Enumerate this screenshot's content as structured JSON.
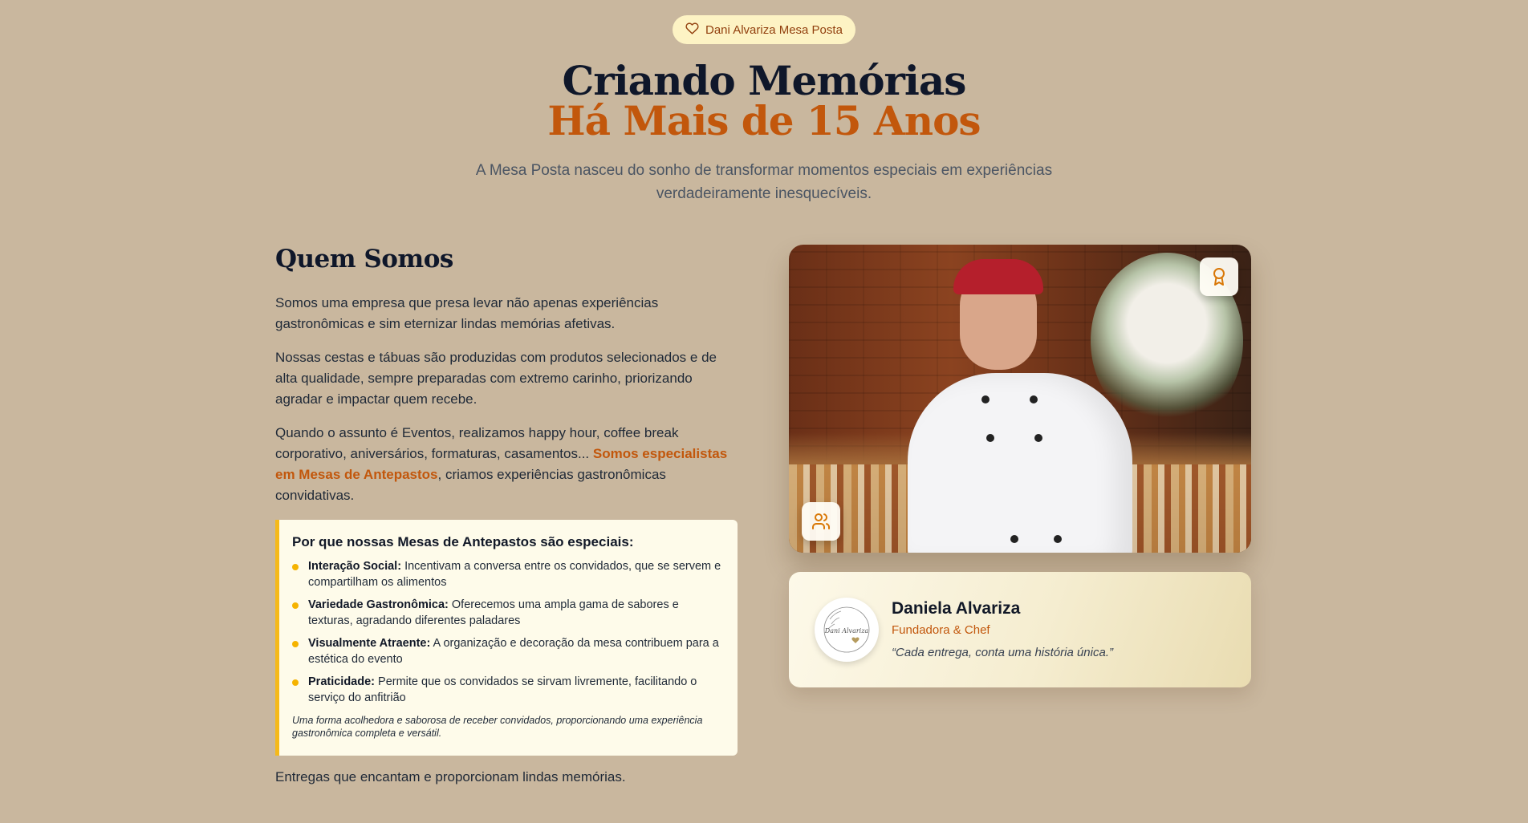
{
  "badge": {
    "icon": "heart-icon",
    "label": "Dani Alvariza Mesa Posta"
  },
  "hero": {
    "title_line1": "Criando Memórias",
    "title_line2": "Há Mais de 15 Anos",
    "subtitle": "A Mesa Posta nasceu do sonho de transformar momentos especiais em experiências verdadeiramente inesquecíveis."
  },
  "about": {
    "heading": "Quem Somos",
    "p1": "Somos uma empresa que presa levar não apenas experiências gastronômicas e sim eternizar lindas memórias afetivas.",
    "p2": "Nossas cestas e tábuas são produzidas com produtos selecionados e de alta qualidade, sempre preparadas com extremo carinho, priorizando agradar e impactar quem recebe.",
    "p3_start": "Quando o assunto é Eventos, realizamos happy hour, coffee break corporativo, aniversários, formaturas, casamentos... ",
    "p3_highlight": "Somos especialistas em Mesas de Antepastos",
    "p3_end": ", criamos experiências gastronômicas convidativas.",
    "closing": "Entregas que encantam e proporcionam lindas memórias."
  },
  "features_box": {
    "title": "Por que nossas Mesas de Antepastos são especiais:",
    "items": [
      {
        "label": "Interação Social:",
        "text": " Incentivam a conversa entre os convidados, que se servem e compartilham os alimentos"
      },
      {
        "label": "Variedade Gastronômica:",
        "text": " Oferecemos uma ampla gama de sabores e texturas, agradando diferentes paladares"
      },
      {
        "label": "Visualmente Atraente:",
        "text": " A organização e decoração da mesa contribuem para a estética do evento"
      },
      {
        "label": "Praticidade:",
        "text": " Permite que os convidados se sirvam livremente, facilitando o serviço do anfitrião"
      }
    ],
    "note": "Uma forma acolhedora e saborosa de receber convidados, proporcionando uma experiência gastronômica completa e versátil."
  },
  "photo": {
    "top_icon": "award-icon",
    "bottom_icon": "users-icon"
  },
  "founder": {
    "name": "Daniela Alvariza",
    "role": "Fundadora & Chef",
    "quote": "“Cada entrega, conta uma história única.”",
    "logo_text": "Dani Alvariza"
  },
  "colors": {
    "background": "#c9b79e",
    "accent": "#c2570c",
    "badge_bg": "#fdf3c4",
    "bullet": "#f5b300"
  }
}
